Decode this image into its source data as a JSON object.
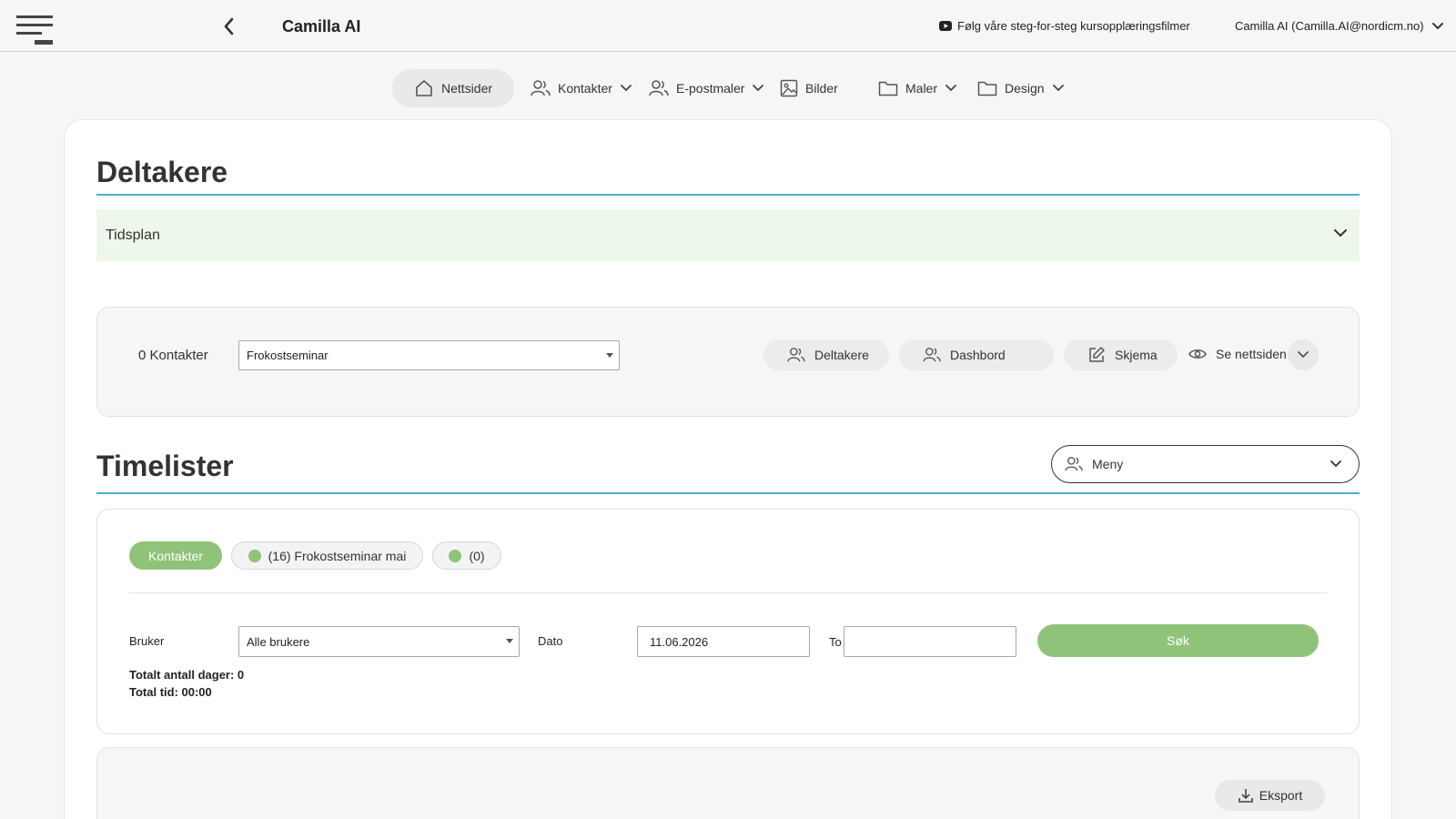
{
  "topbar": {
    "title": "Camilla AI",
    "tutorial_link": "Følg våre steg-for-steg kursopplæringsfilmer",
    "user": "Camilla AI (Camilla.AI@nordicm.no)"
  },
  "nav": {
    "items": [
      {
        "label": "Nettsider",
        "icon": "home-icon",
        "active": true
      },
      {
        "label": "Kontakter",
        "icon": "users-icon",
        "dropdown": true
      },
      {
        "label": "E-postmaler",
        "icon": "users-icon",
        "dropdown": true
      },
      {
        "label": "Bilder",
        "icon": "image-icon"
      },
      {
        "label": "Maler",
        "icon": "folder-icon",
        "dropdown": true
      },
      {
        "label": "Design",
        "icon": "folder-icon",
        "dropdown": true
      }
    ]
  },
  "deltakere": {
    "heading": "Deltakere",
    "tidsplan": "Tidsplan",
    "contacts_count": "0 Kontakter",
    "event_select": "Frokostseminar",
    "buttons": {
      "deltakere": "Deltakere",
      "dashbord": "Dashbord",
      "skjema": "Skjema",
      "se_nettsiden": "Se nettsiden"
    }
  },
  "timelister": {
    "heading": "Timelister",
    "meny": "Meny",
    "tabs": [
      {
        "label": "Kontakter",
        "active": true
      },
      {
        "label": "(16) Frokostseminar mai",
        "dot": true
      },
      {
        "label": "(0)",
        "dot": true
      }
    ],
    "form": {
      "bruker_label": "Bruker",
      "bruker_value": "Alle brukere",
      "dato_label": "Dato",
      "dato_value": "11.06.2026",
      "to_label": "To",
      "to_value": "",
      "search_button": "Søk"
    },
    "totals": {
      "days": "Totalt antall dager: 0",
      "time": "Total tid: 00:00"
    },
    "export_button": "Eksport"
  },
  "colors": {
    "accent_green": "#8fc37a",
    "heading_rule": "#4ab0d0",
    "tidsplan_bg": "#eef8ea"
  }
}
